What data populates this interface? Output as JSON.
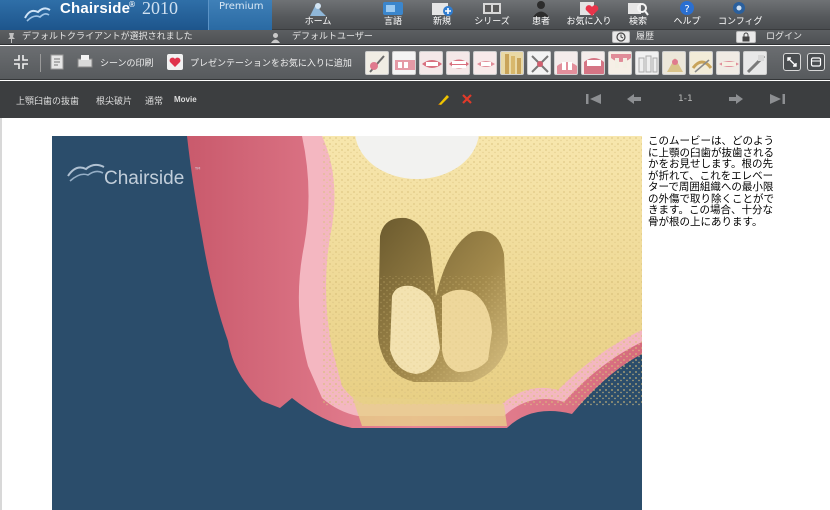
{
  "brand": {
    "name": "Chairside",
    "year": "2010",
    "edition": "Premium"
  },
  "nav": [
    {
      "label": "ホーム",
      "icon": "home-icon"
    },
    {
      "label": "言語",
      "icon": "language-icon"
    },
    {
      "label": "新規",
      "icon": "new-icon"
    },
    {
      "label": "シリーズ",
      "icon": "series-icon"
    },
    {
      "label": "患者",
      "icon": "patient-icon"
    },
    {
      "label": "お気に入り",
      "icon": "favorites-icon"
    },
    {
      "label": "検索",
      "icon": "search-icon"
    },
    {
      "label": "ヘルプ",
      "icon": "help-icon"
    },
    {
      "label": "コンフィグ",
      "icon": "config-icon"
    }
  ],
  "status": {
    "client": "デフォルトクライアントが選択されました",
    "user": "デフォルトユーザー",
    "history": "履歴",
    "login": "ログイン"
  },
  "toolbar": {
    "print_scene": "シーンの印刷",
    "add_favorite": "プレゼンテーションをお気に入りに追加"
  },
  "title": {
    "scene": "上顎臼歯の抜歯",
    "subtitle": "根尖破片",
    "mode": "通常",
    "type": "Movie",
    "page": "1-1"
  },
  "video": {
    "watermark": "Chairside",
    "tm": "™"
  },
  "description": "このムービーは、どのように上顎の臼歯が抜歯されるかをお見せします。根の先が折れて、これをエレベーターで周囲組織への最小限の外傷で取り除くことができます。この場合、十分な骨が根の上にあります。",
  "colors": {
    "brand_blue": "#1d558c",
    "video_bg": "#2b4d6b",
    "gum": "#e07a8e",
    "bone": "#f2dc9a",
    "delete_red": "#e03a2a",
    "edit_yellow": "#f0c400"
  }
}
